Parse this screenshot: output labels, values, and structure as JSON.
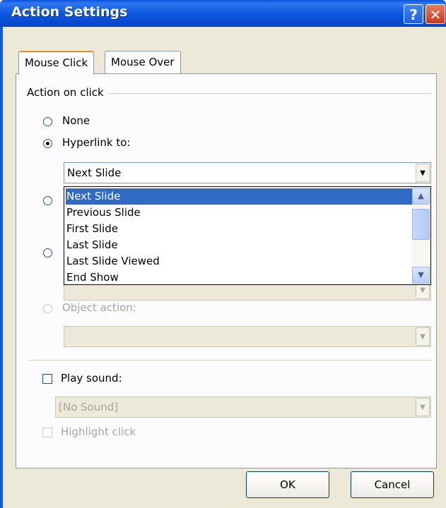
{
  "window": {
    "title": "Action Settings",
    "help_glyph": "?",
    "close_glyph": "✕"
  },
  "tabs": [
    {
      "label": "Mouse Click"
    },
    {
      "label": "Mouse Over"
    }
  ],
  "group_label": "Action on click",
  "options": {
    "none": "None",
    "hyperlink": "Hyperlink to:",
    "object_action": "Object action:"
  },
  "hyperlink_combo": {
    "value": "Next Slide"
  },
  "hyperlink_list": {
    "items": [
      "Next Slide",
      "Previous Slide",
      "First Slide",
      "Last Slide",
      "Last Slide Viewed",
      "End Show"
    ],
    "selected_index": 0
  },
  "object_combo": {
    "value": ""
  },
  "play_sound": {
    "label": "Play sound:",
    "value": "[No Sound]"
  },
  "highlight_click": {
    "label": "Highlight click"
  },
  "buttons": {
    "ok": "OK",
    "cancel": "Cancel"
  },
  "icons": {
    "dropdown": "chevron-down-icon",
    "scroll_up": "chevron-up-icon",
    "scroll_down": "chevron-down-icon"
  }
}
